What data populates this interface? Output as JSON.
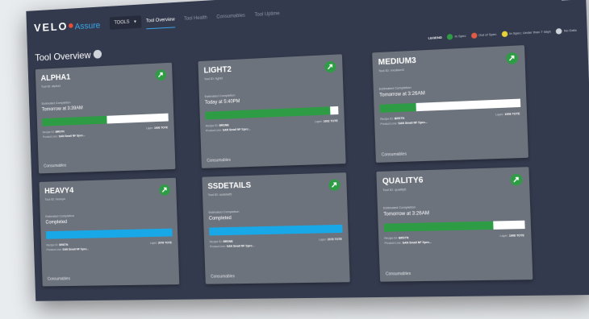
{
  "brand": {
    "name": "VELO",
    "sub": "Assure"
  },
  "header": {
    "tools_select": "TOOLS",
    "nav": [
      "Tool Overview",
      "Tool Health",
      "Consumables",
      "Tool Uptime"
    ],
    "active_nav": "Tool Overview"
  },
  "page": {
    "title": "Tool Overview"
  },
  "legend": {
    "title": "LEGEND",
    "items": [
      {
        "label": "In Spec",
        "color": "#2e9c44"
      },
      {
        "label": "Out of Spec",
        "color": "#e05a45"
      },
      {
        "label": "In Spec; Under than 7 days",
        "color": "#e8d23a"
      },
      {
        "label": "No Data",
        "color": "#cfd3da"
      }
    ]
  },
  "cards": [
    {
      "name": "ALPHA1",
      "tool_id": "Tool ID: alpha1",
      "est_label": "Estimated Completion",
      "est_value": "Tomorrow at 3:39AM",
      "progress": 0.52,
      "bar_color": "#2e9c44",
      "recipe_label": "Recipe ID:",
      "recipe": "BRSTN",
      "prod_label": "Product Line:",
      "prod": "SAN Small NF Spec...",
      "total_label": "Layer:",
      "total": "1906 TOTE",
      "consumables": "Consumables",
      "status_color": "#2e9c44"
    },
    {
      "name": "LIGHT2",
      "tool_id": "Tool ID: light2",
      "est_label": "Estimated Completion",
      "est_value": "Today at 5:40PM",
      "progress": 0.94,
      "bar_color": "#2e9c44",
      "recipe_label": "Recipe ID:",
      "recipe": "BRSNB",
      "prod_label": "Product Line:",
      "prod": "SAN Small NF Spec...",
      "total_label": "Layer:",
      "total": "1902 TOTE",
      "consumables": "Consumables",
      "status_color": "#2e9c44"
    },
    {
      "name": "MEDIUM3",
      "tool_id": "Tool ID: medium3",
      "est_label": "Estimated Completion",
      "est_value": "Tomorrow at 3:26AM",
      "progress": 0.26,
      "bar_color": "#2e9c44",
      "recipe_label": "Recipe ID:",
      "recipe": "BRSTN",
      "prod_label": "Product Line:",
      "prod": "SAN Small NF Spec...",
      "total_label": "Layer:",
      "total": "1906 TOTE",
      "consumables": "Consumables",
      "status_color": "#2e9c44"
    },
    {
      "name": "HEAVY4",
      "tool_id": "Tool ID: heavy4",
      "est_label": "Estimated Completion",
      "est_value": "Completed",
      "progress": 1.0,
      "bar_color": "#18a8e8",
      "recipe_label": "Recipe ID:",
      "recipe": "BRSTN",
      "prod_label": "Product Line:",
      "prod": "SAN Small NF Spec...",
      "total_label": "Layer:",
      "total": "2078 TOTE",
      "consumables": "Consumables",
      "status_color": "#2e9c44"
    },
    {
      "name": "SSDETAILS",
      "tool_id": "Tool ID: ssdetail5",
      "est_label": "Estimated Completion",
      "est_value": "Completed",
      "progress": 1.0,
      "bar_color": "#18a8e8",
      "recipe_label": "Recipe ID:",
      "recipe": "BRSNB",
      "prod_label": "Product Line:",
      "prod": "SAN Small NF Spec...",
      "total_label": "Layer:",
      "total": "2078 TOTE",
      "consumables": "Consumables",
      "status_color": "#2e9c44"
    },
    {
      "name": "QUALITY6",
      "tool_id": "Tool ID: quality6",
      "est_label": "Estimated Completion",
      "est_value": "Tomorrow at 3:26AM",
      "progress": 0.78,
      "bar_color": "#2e9c44",
      "recipe_label": "Recipe ID:",
      "recipe": "BRSTN",
      "prod_label": "Product Line:",
      "prod": "SAN Small NF Spec...",
      "total_label": "Layer:",
      "total": "1906 TOTE",
      "consumables": "Consumables",
      "status_color": "#2e9c44"
    }
  ]
}
